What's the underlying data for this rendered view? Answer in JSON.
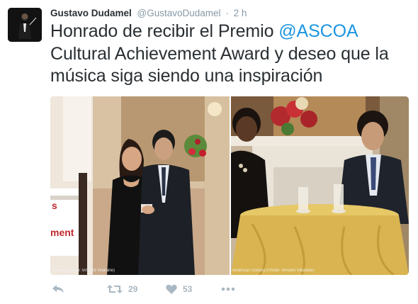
{
  "tweet": {
    "author_name": "Gustavo Dudamel",
    "username": "@GustavoDudamel",
    "separator": "·",
    "time": "2 h",
    "text_before": "Honrado de recibir el Premio ",
    "mention": "@ASCOA",
    "text_after": " Cultural Achievement Award y deseo que la música siga siendo una inspiración"
  },
  "media": {
    "left_caption": "Society (Photo: Vincent Villafañe)",
    "right_caption": "Americas Society (Photo: Vincent Villafañe)",
    "sign_text_top": "s",
    "sign_text_bottom": "ment"
  },
  "actions": {
    "retweet_count": "29",
    "like_count": "53"
  },
  "icons": {
    "reply": "reply-icon",
    "retweet": "retweet-icon",
    "like": "heart-icon",
    "more": "more-icon"
  },
  "colors": {
    "mention": "#1b95e0",
    "meta": "#8899a6",
    "action": "#aab8c2",
    "text": "#292f33"
  }
}
